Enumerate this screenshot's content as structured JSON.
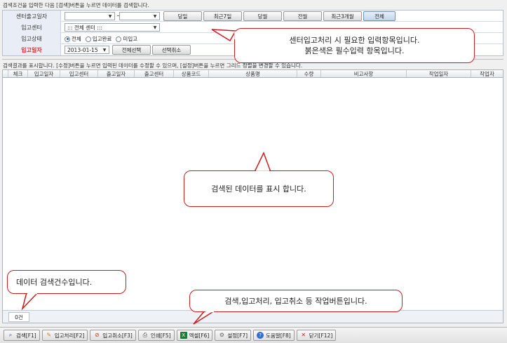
{
  "search": {
    "caption": "검색조건을 입력한 다음 [검색]버튼을 누르면 데이터를 검색합니다.",
    "date_sep": "~",
    "fields": {
      "ship_center_label": "센터출고일자",
      "in_center_label": "입고센터",
      "in_center_value": "::: 전체 센터 :::",
      "in_status_label": "입고상태",
      "in_date_label": "입고일자",
      "in_date_value": "2013-01-15"
    },
    "period_buttons": [
      "당일",
      "최근7일",
      "당월",
      "전월",
      "최근3개월",
      "전체"
    ],
    "status_options": [
      "전체",
      "입고완료",
      "미입고"
    ],
    "select_all": "전체선택",
    "deselect_all": "선택취소"
  },
  "results": {
    "caption": "검색결과를 표시합니다. [수정]버튼을 누르면 입력된 데이터를 수정할 수 있으며, [설정]버튼을 누르면 그리드 정렬을 변경할 수 있습니다.",
    "columns": [
      "체크",
      "입고일자",
      "입고센터",
      "출고일자",
      "출고센터",
      "상품코드",
      "상품명",
      "수량",
      "비고사항",
      "작업일자",
      "작업자"
    ],
    "count": "0건"
  },
  "callouts": {
    "input_note_line1": "센터입고처리 시 필요한 입력항목입니다.",
    "input_note_line2": "붉은색은 필수입력 항목입니다.",
    "grid_note": "검색된 데이터를 표시 합니다.",
    "count_note": "데이터 검색건수입니다.",
    "toolbar_note": "검색,입고처리, 입고취소  등 작업버튼입니다."
  },
  "toolbar": {
    "buttons": [
      {
        "label": "검색[F1]",
        "icon": "magnifier-icon"
      },
      {
        "label": "입고처리[F2]",
        "icon": "pencil-icon"
      },
      {
        "label": "입고취소[F3]",
        "icon": "cancel-icon"
      },
      {
        "label": "인쇄[F5]",
        "icon": "printer-icon"
      },
      {
        "label": "엑셀[F6]",
        "icon": "excel-icon"
      },
      {
        "label": "설정[F7]",
        "icon": "gear-icon"
      },
      {
        "label": "도움말[F8]",
        "icon": "help-icon"
      },
      {
        "label": "닫기[F12]",
        "icon": "close-icon"
      }
    ]
  },
  "colors": {
    "required_label": "#d03030",
    "callout_border": "#c81e1e"
  }
}
